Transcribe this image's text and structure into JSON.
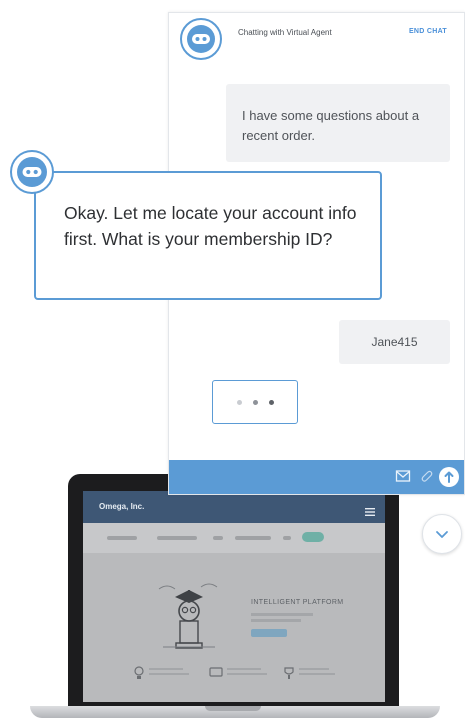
{
  "chat": {
    "header_title": "Chatting with Virtual Agent",
    "end_chat_label": "END CHAT",
    "user_message_1": "I have some questions about a recent order.",
    "agent_message": "Okay. Let me locate your account info first.  What is your membership ID?",
    "user_message_2": "Jane415"
  },
  "laptop_site": {
    "logo_text": "Omega, Inc.",
    "hero_title": "INTELLIGENT PLATFORM"
  },
  "colors": {
    "accent": "#5b9bd5",
    "bubble_bg": "#f0f1f3",
    "site_nav": "#3e5775"
  },
  "icons": {
    "avatar": "robot-icon",
    "footer": [
      "mail-icon",
      "paperclip-icon",
      "send-arrow-icon"
    ],
    "scroll": "chevron-down-icon"
  }
}
